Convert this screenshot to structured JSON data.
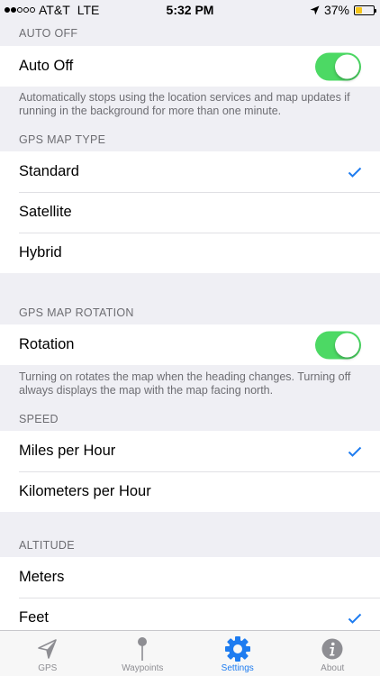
{
  "status_bar": {
    "carrier": "AT&T",
    "network": "LTE",
    "time": "5:32 PM",
    "battery": "37%",
    "battery_level": 0.37,
    "signal_bars": 2
  },
  "sections": {
    "auto_off": {
      "header": "AUTO OFF",
      "toggle_label": "Auto Off",
      "toggle_on": true,
      "footer": "Automatically stops using the location services and map updates if running in the background for more than one minute."
    },
    "map_type": {
      "header": "GPS MAP TYPE",
      "options": [
        "Standard",
        "Satellite",
        "Hybrid"
      ],
      "selected": "Standard"
    },
    "map_rotation": {
      "header": "GPS MAP ROTATION",
      "toggle_label": "Rotation",
      "toggle_on": true,
      "footer": "Turning on rotates the map when the heading changes.  Turning off always displays the map with the map facing north."
    },
    "speed": {
      "header": "SPEED",
      "options": [
        "Miles per Hour",
        "Kilometers per Hour"
      ],
      "selected": "Miles per Hour"
    },
    "altitude": {
      "header": "ALTITUDE",
      "options": [
        "Meters",
        "Feet"
      ],
      "selected": "Feet"
    }
  },
  "tab_bar": {
    "tabs": [
      {
        "label": "GPS",
        "icon": "location-arrow-icon"
      },
      {
        "label": "Waypoints",
        "icon": "pin-icon"
      },
      {
        "label": "Settings",
        "icon": "gear-icon"
      },
      {
        "label": "About",
        "icon": "info-icon"
      }
    ],
    "active": "Settings"
  },
  "colors": {
    "accent": "#1e7cf0",
    "toggle_on": "#4cd964",
    "background": "#efeff4",
    "battery": "#f5c518"
  }
}
